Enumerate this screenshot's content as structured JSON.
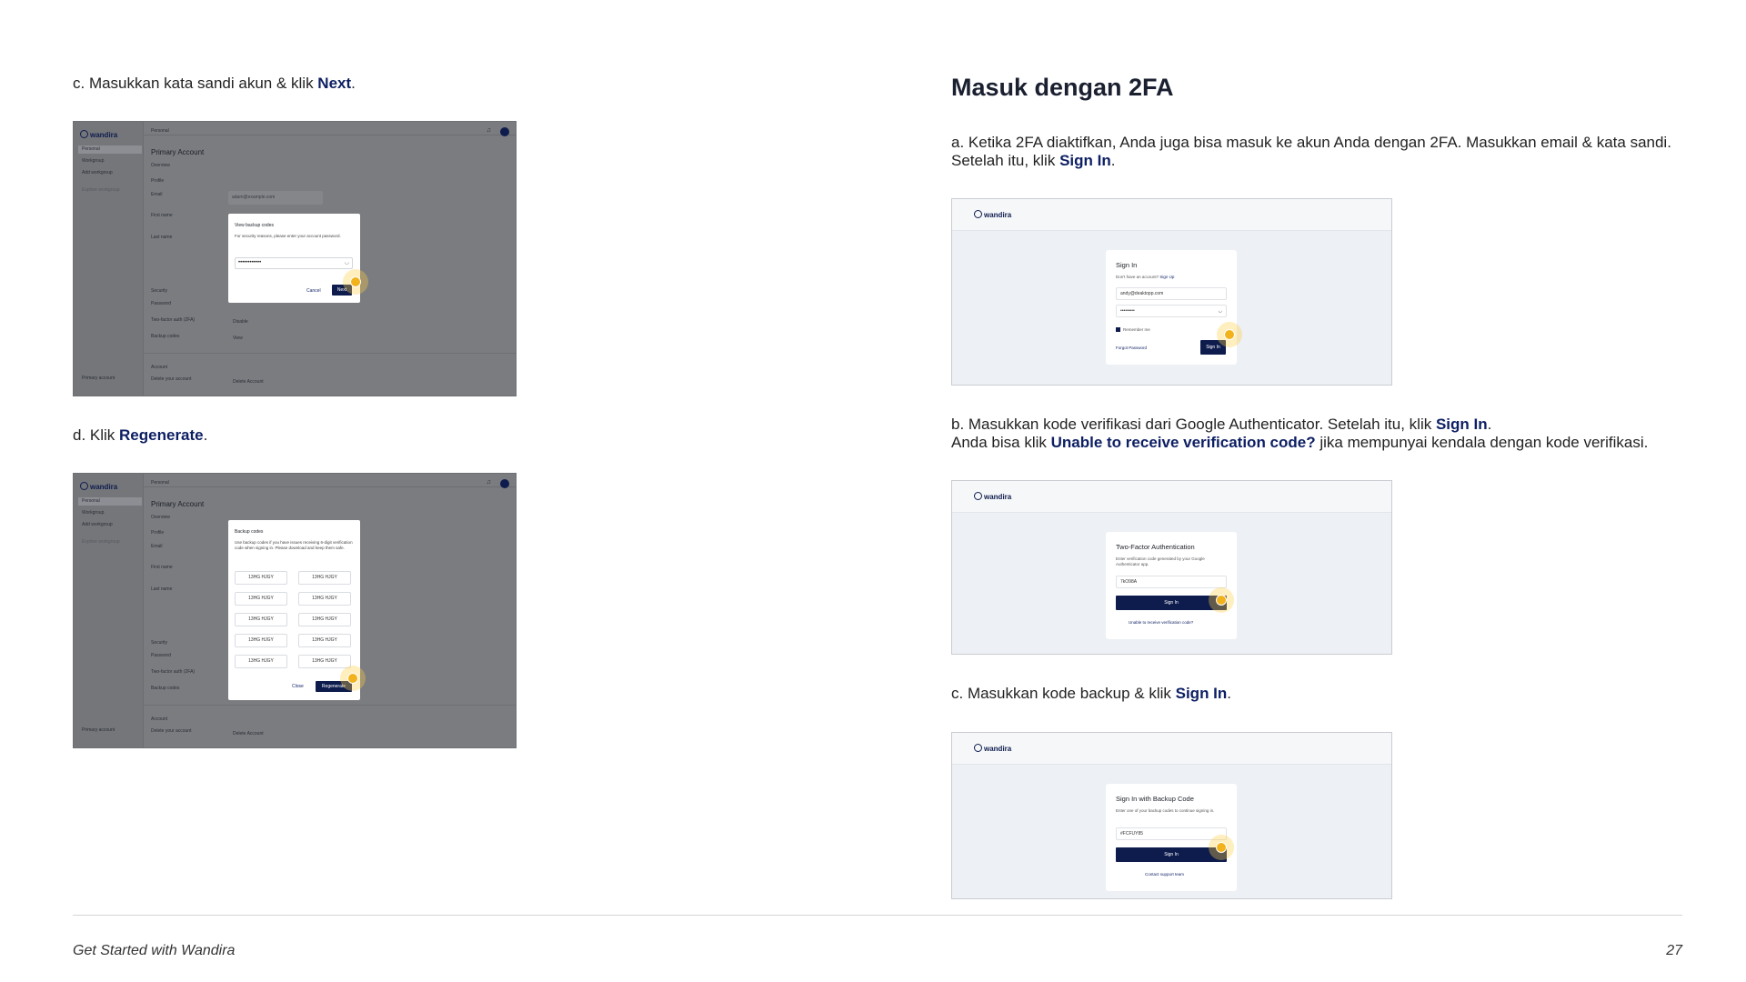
{
  "left": {
    "step_c": {
      "prefix": "c. Masukkan kata sandi akun & klik ",
      "bold": "Next",
      "suffix": "."
    },
    "step_d": {
      "prefix": "d. Klik ",
      "bold": "Regenerate",
      "suffix": "."
    },
    "app": {
      "brand": "wandira",
      "crumb": "Personal",
      "sidebar": [
        "Personal",
        "Workgroup",
        "Add workgroup"
      ],
      "sidebar_note": [
        "Explore workgroup",
        "Create and join team for",
        "better experience"
      ],
      "sidebar_footer": [
        "Primary account",
        "andy@ws.example"
      ],
      "page_title": "Primary Account",
      "tab": "Overview",
      "profile_heading": "Profile",
      "labels": {
        "email": "Email",
        "first": "First name",
        "last": "Last name",
        "security": "Security",
        "password": "Password",
        "twofa": "Two-factor auth (2FA)",
        "backup": "Backup codes",
        "account": "Account",
        "delete": "Delete your account"
      },
      "values": {
        "email": "adam@example.com",
        "change_password": "Change Password",
        "disable": "Disable",
        "view": "View",
        "delete_account": "Delete Account"
      }
    },
    "modal1": {
      "title": "View backup codes",
      "desc": "For security reasons, please enter your account password.",
      "password": "••••••••••••",
      "cancel": "Cancel",
      "next": "Next"
    },
    "modal2": {
      "title": "Backup codes",
      "desc": "Use backup codes if you have issues receiving 6-digit verification code when signing in. Please download and keep them safe.",
      "codes": [
        "13HG HJGY",
        "13HG HJGY",
        "13HG HJGY",
        "13HG HJGY",
        "13HG HJGY",
        "13HG HJGY",
        "13HG HJGY",
        "13HG HJGY",
        "13HG HJGY",
        "13HG HJGY"
      ],
      "close": "Close",
      "regenerate": "Regenerate"
    }
  },
  "right": {
    "heading": "Masuk dengan 2FA",
    "step_a": {
      "line1": "a. Ketika 2FA diaktifkan, Anda juga bisa masuk ke akun Anda dengan 2FA. Masukkan email & kata sandi.",
      "line2_prefix": "Setelah itu, klik ",
      "line2_bold": "Sign In",
      "line2_suffix": "."
    },
    "step_b": {
      "line1_prefix": "b. Masukkan kode verifikasi dari Google Authenticator. Setelah itu, klik ",
      "line1_bold": "Sign In",
      "line1_suffix": ".",
      "line2_prefix": "Anda bisa klik ",
      "line2_bold": "Unable to receive verification code?",
      "line2_suffix": " jika mempunyai kendala dengan kode verifikasi."
    },
    "step_c": {
      "prefix": "c. Masukkan kode backup & klik ",
      "bold": "Sign In",
      "suffix": "."
    },
    "brand": "wandira",
    "signin": {
      "title": "Sign In",
      "no_account": "Don't have an account?",
      "signup": "Sign Up",
      "email": "andy@deaktopp.com",
      "password": "•••••••••",
      "remember": "Remember me",
      "forgot": "Forgot Password",
      "button": "Sign In"
    },
    "twofa": {
      "title": "Two-Factor Authentication",
      "desc": "Enter verification code generated by your Google Authenticator app.",
      "code": "7kO98A",
      "button": "Sign In",
      "link": "Unable to receive verification code?"
    },
    "backup": {
      "title": "Sign In with Backup Code",
      "desc": "Enter one of your backup codes to continue signing in.",
      "code": "#FCFUY85",
      "button": "Sign In",
      "link": "Contact support team"
    }
  },
  "footer": {
    "title": "Get Started with Wandira",
    "page": "27"
  }
}
